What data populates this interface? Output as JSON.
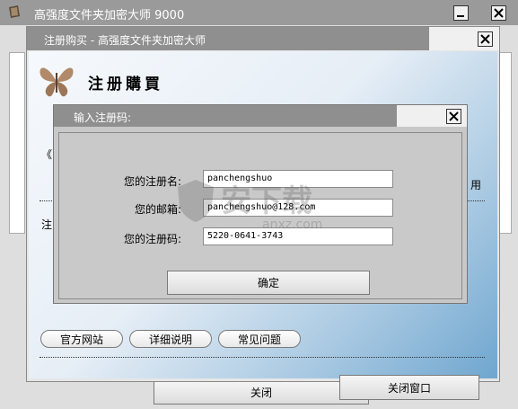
{
  "main_window": {
    "title": "高强度文件夹加密大师 9000",
    "close_label": "关闭"
  },
  "purchase_window": {
    "title": "注册购买 - 高强度文件夹加密大师",
    "heading": "注册購買",
    "links": [
      "官方网站",
      "详细说明",
      "常见问题"
    ],
    "close_window_label": "关闭窗口",
    "bg_snippets": {
      "left_mark": "《",
      "left_char": "注",
      "right_text": "用"
    }
  },
  "register_dialog": {
    "title": "输入注册码:",
    "fields": [
      {
        "label": "您的注册名:",
        "value": "panchengshuo"
      },
      {
        "label": "您的邮箱:",
        "value": "panchengshuo@128.com"
      },
      {
        "label": "您的注册码:",
        "value": "5220-0641-3743"
      }
    ],
    "confirm_label": "确定"
  },
  "watermark": {
    "text": "安下载",
    "domain": "anxz.com"
  },
  "colors": {
    "titlebar": "#8f8f8f",
    "panel_gradient_start": "#f4f8fc",
    "panel_gradient_end": "#6fa6cf",
    "dialog_body": "#c8c8c8"
  }
}
